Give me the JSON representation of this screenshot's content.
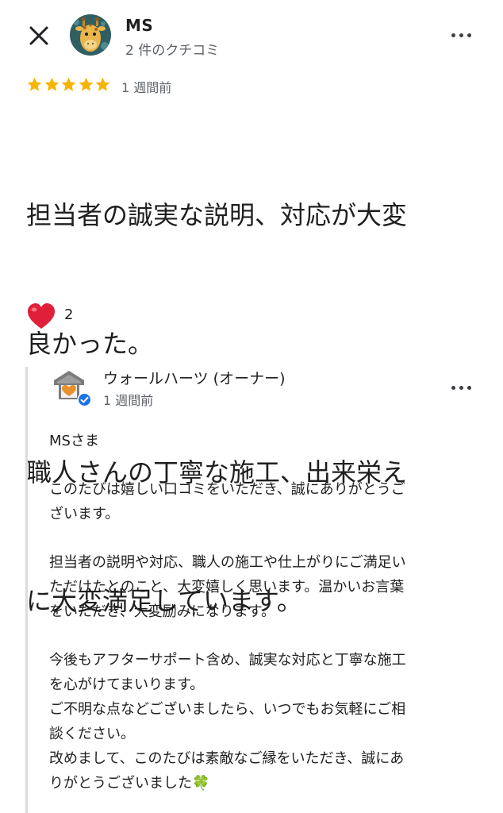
{
  "header": {
    "reviewer_name": "MS",
    "reviewer_review_count": "2 件のクチコミ"
  },
  "review": {
    "rating": 5,
    "max_rating": 5,
    "time_ago": "1 週間前",
    "text_lines": [
      "担当者の誠実な説明、対応が大変",
      "良かった。",
      "職人さんの丁寧な施工、出来栄え",
      "に大変満足しています。"
    ],
    "reaction_count": "2",
    "star_color": "#f6b400"
  },
  "owner_reply": {
    "name": "ウォールハーツ (オーナー)",
    "time_ago": "1 週間前",
    "verified_color": "#1a73e8",
    "lines": [
      "MSさま",
      "",
      "このたびは嬉しい口コミをいただき、誠にありがとうご",
      "ざいます。",
      "",
      "担当者の説明や対応、職人の施工や仕上がりにご満足い",
      "ただけたとのこと、大変嬉しく思います。温かいお言葉",
      "をいただき、大変励みになります。",
      "",
      "今後もアフターサポート含め、誠実な対応と丁寧な施工",
      "を心がけてまいります。",
      "ご不明な点などございましたら、いつでもお気軽にご相",
      "談ください。",
      "改めまして、このたびは素敵なご縁をいただき、誠にあ",
      "りがとうございました🍀"
    ]
  }
}
